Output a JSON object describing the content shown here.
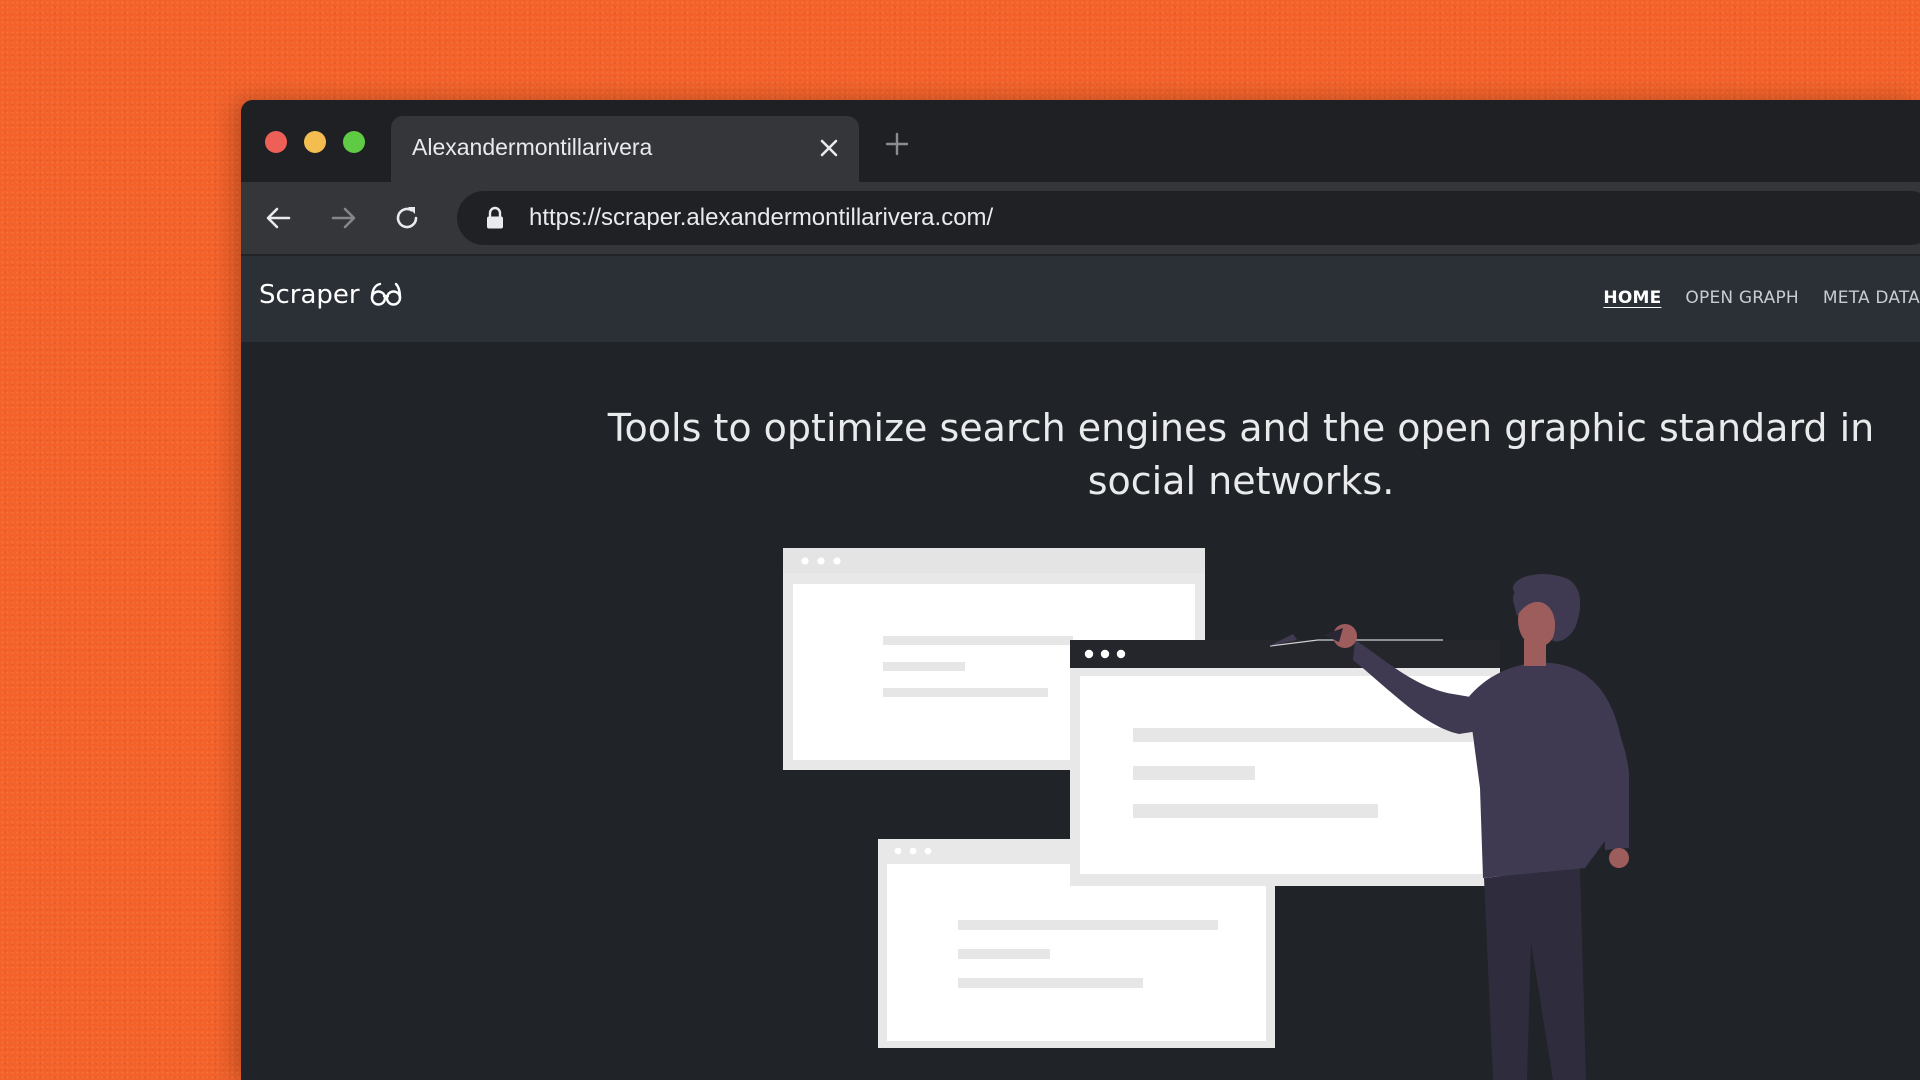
{
  "browser": {
    "tab_title": "Alexandermontillarivera",
    "url": "https://scraper.alexandermontillarivera.com/"
  },
  "site": {
    "brand": "Scraper",
    "nav": [
      {
        "label": "HOME",
        "active": true
      },
      {
        "label": "OPEN GRAPH",
        "active": false
      },
      {
        "label": "META DATA",
        "active": false
      }
    ],
    "headline": "Tools to optimize search engines and the open graphic standard in social networks."
  },
  "colors": {
    "background_orange": "#f4622a",
    "window_dark": "#202327",
    "nav_bar": "#2b3037",
    "figure_body": "#3f3a52",
    "figure_skin": "#9e5d5d"
  },
  "icons": [
    "close-icon",
    "new-tab-icon",
    "back-arrow-icon",
    "forward-arrow-icon",
    "reload-icon",
    "lock-icon",
    "glasses-icon"
  ]
}
